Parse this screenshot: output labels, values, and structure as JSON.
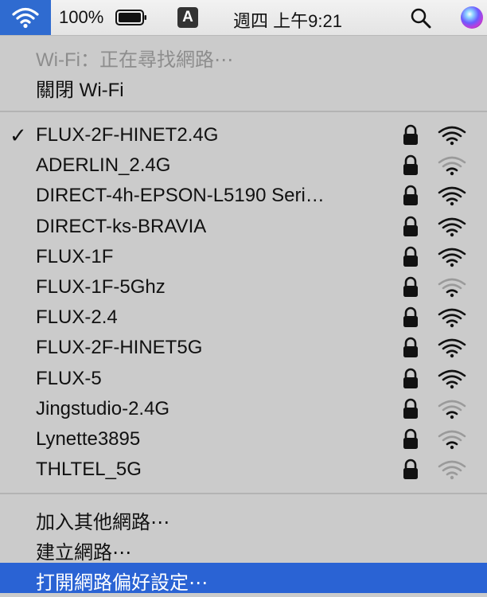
{
  "menubar": {
    "battery_percent": "100%",
    "input_source": "A",
    "clock": "週四 上午9:21",
    "icons": [
      "wifi-icon",
      "battery-icon",
      "search-icon",
      "siri-icon"
    ]
  },
  "wifi_menu": {
    "status": "Wi-Fi：正在尋找網路⋯",
    "toggle_label": "關閉 Wi-Fi",
    "networks": [
      {
        "name": "FLUX-2F-HINET2.4G",
        "connected": true,
        "locked": true,
        "signal": 3
      },
      {
        "name": "ADERLIN_2.4G",
        "connected": false,
        "locked": true,
        "signal": 1
      },
      {
        "name": "DIRECT-4h-EPSON-L5190 Seri…",
        "connected": false,
        "locked": true,
        "signal": 3
      },
      {
        "name": "DIRECT-ks-BRAVIA",
        "connected": false,
        "locked": true,
        "signal": 3
      },
      {
        "name": "FLUX-1F",
        "connected": false,
        "locked": true,
        "signal": 3
      },
      {
        "name": "FLUX-1F-5Ghz",
        "connected": false,
        "locked": true,
        "signal": 1
      },
      {
        "name": "FLUX-2.4",
        "connected": false,
        "locked": true,
        "signal": 3
      },
      {
        "name": "FLUX-2F-HINET5G",
        "connected": false,
        "locked": true,
        "signal": 3
      },
      {
        "name": "FLUX-5",
        "connected": false,
        "locked": true,
        "signal": 3
      },
      {
        "name": "Jingstudio-2.4G",
        "connected": false,
        "locked": true,
        "signal": 1
      },
      {
        "name": "Lynette3895",
        "connected": false,
        "locked": true,
        "signal": 1
      },
      {
        "name": "THLTEL_5G",
        "connected": false,
        "locked": true,
        "signal": 0
      }
    ],
    "check_mark": "✓",
    "actions": {
      "join_other": "加入其他網路⋯",
      "create_network": "建立網路⋯",
      "open_prefs": "打開網路偏好設定⋯"
    }
  },
  "colors": {
    "highlight": "#2a63d4",
    "menu_bg": "#cbcbcb",
    "disabled_text": "#8d8d8d"
  }
}
